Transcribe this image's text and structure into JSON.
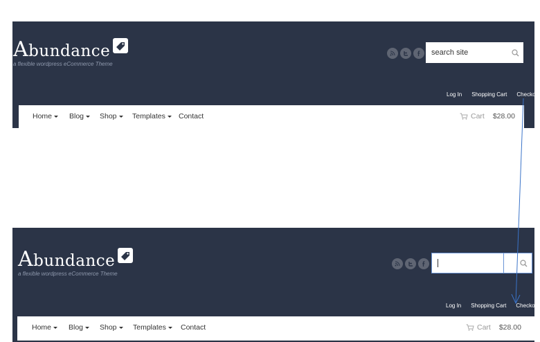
{
  "brand": {
    "name_first": "A",
    "name_rest": "bundance",
    "tagline": "a flexible wordpress eCommerce Theme"
  },
  "social_icons": [
    "rss-icon",
    "twitter-icon",
    "facebook-icon"
  ],
  "search": {
    "placeholder": "search site",
    "value_focused": ""
  },
  "top_links": [
    "Log In",
    "Shopping Cart",
    "Checkout"
  ],
  "nav": {
    "items": [
      {
        "label": "Home",
        "dropdown": true
      },
      {
        "label": "Blog",
        "dropdown": true
      },
      {
        "label": "Shop",
        "dropdown": true
      },
      {
        "label": "Templates",
        "dropdown": true
      },
      {
        "label": "Contact",
        "dropdown": false
      }
    ],
    "cart_label": "Cart",
    "cart_total": "$28.00"
  },
  "colors": {
    "header_bg": "#2b3447",
    "annotation_arrow": "#3a73c8"
  }
}
